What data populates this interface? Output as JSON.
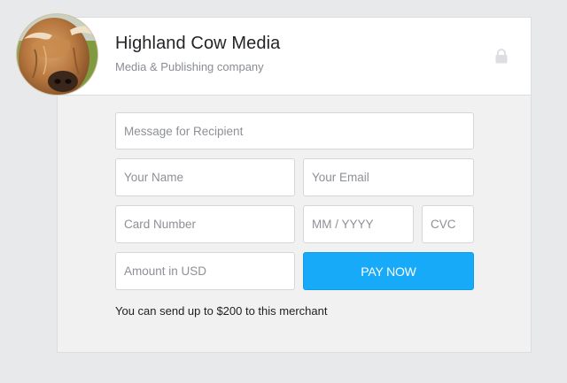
{
  "merchant": {
    "name": "Highland Cow Media",
    "subtitle": "Media & Publishing company",
    "avatar_icon": "highland-cow-photo",
    "lock_icon": "lock-icon"
  },
  "form": {
    "message_placeholder": "Message for Recipient",
    "name_placeholder": "Your Name",
    "email_placeholder": "Your Email",
    "card_placeholder": "Card Number",
    "expiry_placeholder": "MM / YYYY",
    "cvc_placeholder": "CVC",
    "amount_placeholder": "Amount in USD",
    "pay_label": "PAY NOW",
    "limit_note": "You can send up to $200 to this merchant"
  },
  "colors": {
    "accent": "#16aaf8",
    "page_bg": "#e8e9eb",
    "card_bg": "#f1f1f2"
  }
}
